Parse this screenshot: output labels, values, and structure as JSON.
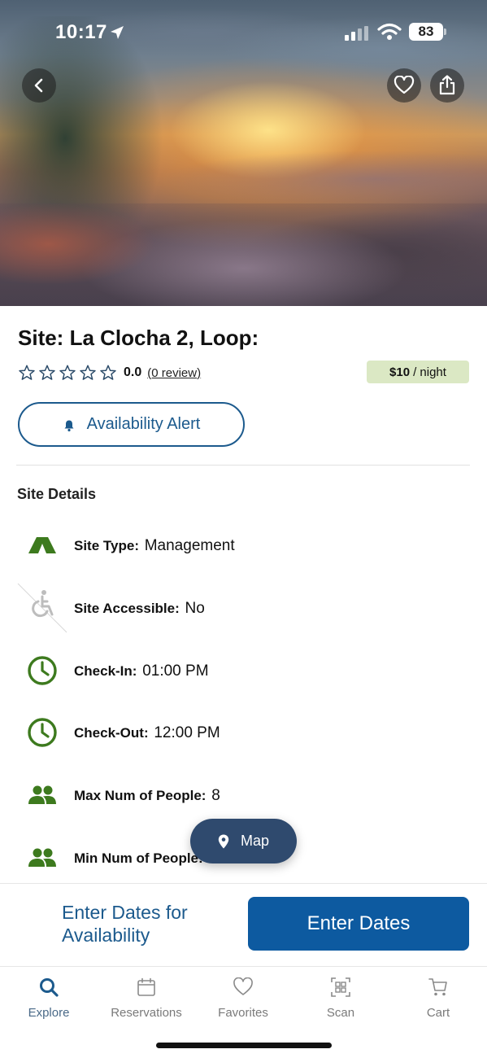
{
  "status_bar": {
    "time": "10:17",
    "battery": "83"
  },
  "header": {
    "back_icon": "chevron-left-icon",
    "favorite_icon": "heart-icon",
    "share_icon": "share-icon"
  },
  "site": {
    "title": "Site: La Clocha 2, Loop:",
    "rating": {
      "stars_filled": 0,
      "stars_total": 5,
      "value": "0.0",
      "reviews": "(0 review)"
    },
    "price": {
      "amount": "$10",
      "unit": "/ night"
    },
    "availability_alert": "Availability Alert"
  },
  "details": {
    "heading": "Site Details",
    "items": [
      {
        "icon": "tent-icon",
        "label": "Site Type:",
        "value": "Management"
      },
      {
        "icon": "accessible-off-icon",
        "label": "Site Accessible:",
        "value": "No"
      },
      {
        "icon": "clock-icon",
        "label": "Check-In:",
        "value": "01:00 PM"
      },
      {
        "icon": "clock-icon",
        "label": "Check-Out:",
        "value": "12:00 PM"
      },
      {
        "icon": "people-icon",
        "label": "Max Num of People:",
        "value": "8"
      },
      {
        "icon": "people-icon",
        "label": "Min Num of People:",
        "value": ""
      }
    ]
  },
  "map_button": "Map",
  "cta": {
    "text": "Enter Dates for Availability",
    "button": "Enter Dates"
  },
  "tabs": [
    {
      "label": "Explore",
      "icon": "search-icon",
      "active": true
    },
    {
      "label": "Reservations",
      "icon": "calendar-icon",
      "active": false
    },
    {
      "label": "Favorites",
      "icon": "heart-icon",
      "active": false
    },
    {
      "label": "Scan",
      "icon": "qr-scan-icon",
      "active": false
    },
    {
      "label": "Cart",
      "icon": "cart-icon",
      "active": false
    }
  ],
  "colors": {
    "primary": "#0d5aa0",
    "accent_green": "#3d7a1e",
    "price_bg": "#dbe8c4",
    "map_button": "#2f4a6e"
  }
}
